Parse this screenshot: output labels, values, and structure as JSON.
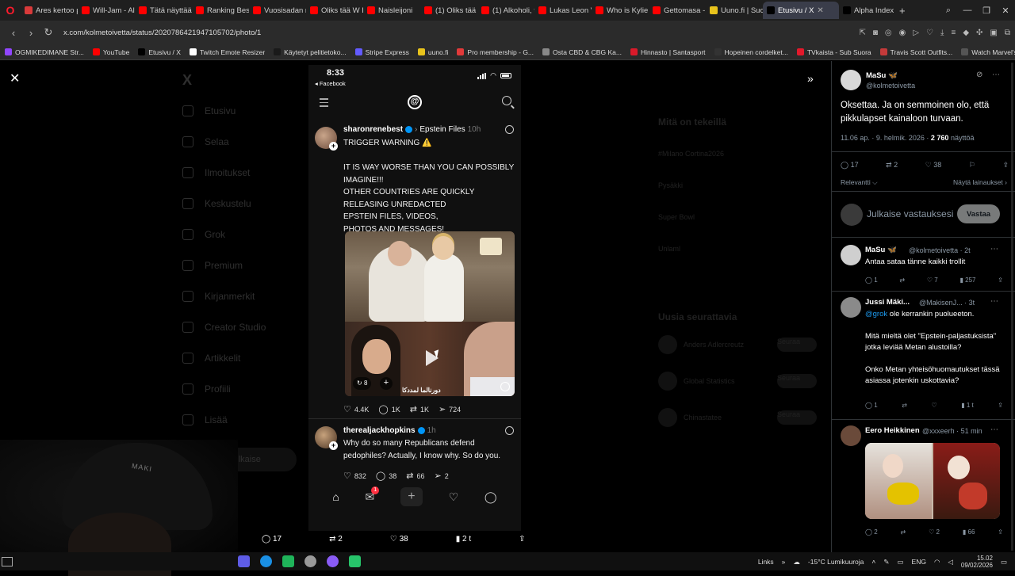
{
  "browser": {
    "tabs": [
      {
        "label": "Ares kertoo p",
        "fav": "#d93a3a"
      },
      {
        "label": "Will-Jam - Alk",
        "fav": "#ff0000"
      },
      {
        "label": "Tätä näyttää S",
        "fav": "#ff0000"
      },
      {
        "label": "Ranking Best I",
        "fav": "#ff0000"
      },
      {
        "label": "Vuosisadan ri",
        "fav": "#ff0000"
      },
      {
        "label": "Oliks tää W Ri",
        "fav": "#ff0000"
      },
      {
        "label": "Naisleijoni",
        "fav": "#ff0000"
      },
      {
        "label": "(1) Oliks tää W",
        "fav": "#ff0000"
      },
      {
        "label": "(1) Alkoholi, t",
        "fav": "#ff0000"
      },
      {
        "label": "Lukas Leon Vi",
        "fav": "#ff0000"
      },
      {
        "label": "Who is Kylie Je",
        "fav": "#ff0000"
      },
      {
        "label": "Gettomasa - S",
        "fav": "#ff0000"
      },
      {
        "label": "Uuno.fi | Suom",
        "fav": "#e8c31c"
      },
      {
        "label": "Etusivu / X",
        "fav": "#000000",
        "active": true
      },
      {
        "label": "Alpha Index X",
        "fav": "#000000"
      }
    ],
    "url": "x.com/kolmetoivetta/status/2020786421947105702/photo/1",
    "bookmarks": [
      {
        "label": "OGMIKEDIMANE Str...",
        "fav": "#9146ff"
      },
      {
        "label": "YouTube",
        "fav": "#ff0000"
      },
      {
        "label": "Etusivu / X",
        "fav": "#000000"
      },
      {
        "label": "Twitch Emote Resizer",
        "fav": "#ffffff"
      },
      {
        "label": "Käytetyt pelitietoko...",
        "fav": "#1a1a1a"
      },
      {
        "label": "Stripe Express",
        "fav": "#635bff"
      },
      {
        "label": "uuno.fi",
        "fav": "#e8c31c"
      },
      {
        "label": "Pro membership - G...",
        "fav": "#e23a3a"
      },
      {
        "label": "Osta CBD & CBG Ka...",
        "fav": "#888888"
      },
      {
        "label": "Hinnasto | Santasport",
        "fav": "#d91a2a"
      },
      {
        "label": "Hopeinen cordelket...",
        "fav": "#333333"
      },
      {
        "label": "TVkaista - Sub Suora",
        "fav": "#e3192b"
      },
      {
        "label": "Travis Scott Outfits...",
        "fav": "#c43a3a"
      },
      {
        "label": "Watch Marvel's Luk...",
        "fav": "#555555"
      }
    ]
  },
  "background": {
    "sidebar_items": [
      "Etusivu",
      "Selaa",
      "Ilmoitukset",
      "Keskustelu",
      "Grok",
      "Premium",
      "Kirjanmerkit",
      "Creator Studio",
      "Artikkelit",
      "Profiili",
      "Lisää"
    ],
    "post_button": "Julkaise",
    "trending_title": "Mitä on tekeillä",
    "trend_items": [
      "#Milano Cortina2026",
      "Pysäkki",
      "Super Bowl",
      "Unlaml"
    ],
    "follow_title": "Uusia seurattavia",
    "follow_items": [
      "Anders Adlercreutz",
      "Global Statistics",
      "Chinastatee"
    ],
    "follow_button": "Seuraa"
  },
  "phone": {
    "time": "8:33",
    "back_app": "◂ Facebook",
    "post1": {
      "user": "sharonrenebest",
      "topic": "Epstein Files",
      "time": "10h",
      "text": "TRIGGER WARNING ⚠️\n\nIT IS WAY WORSE THAN YOU CAN POSSIBLY IMAGINE!!!\nOTHER COUNTRIES ARE QUICKLY RELEASING UNREDACTED\nEPSTEIN FILES, VIDEOS,\nPHOTOS AND MESSAGES!",
      "media_count": "8",
      "subtitle": "ﺩﻭﺭﻧﺎﻟﻤﺎ ﻟﻤﺪﺩﻛﺎ",
      "likes": "4.4K",
      "comments": "1K",
      "reposts": "1K",
      "shares": "724"
    },
    "post2": {
      "user": "therealjackhopkins",
      "time": "1h",
      "text": "Why do so many Republicans defend pedophiles? Actually, I know why. So do you.",
      "likes": "832",
      "comments": "38",
      "reposts": "66",
      "shares": "2"
    },
    "activity_badge": "1"
  },
  "reply_panel": {
    "author_name": "MaSu 🦋",
    "author_handle": "@kolmetoivetta",
    "text": "Oksettaa. Ja on semmoinen olo, että pikkulapset kainaloon turvaan.",
    "meta_time": "11.06 ap. · 9. helmik. 2026 · ",
    "views": "2 760",
    "views_label": "näyttöä",
    "stats": {
      "replies": "17",
      "reposts": "2",
      "likes": "38"
    },
    "sort_label": "Relevantti ⌵",
    "show_quotes": "Näytä lainaukset ›",
    "compose_placeholder": "Julkaise vastauksesi",
    "reply_button": "Vastaa",
    "replies": [
      {
        "name": "MaSu 🦋",
        "handle": "@kolmetoivetta · 2t",
        "text": "Antaa sataa tänne kaikki trollit",
        "acts": [
          "1",
          "",
          "7",
          "257",
          ""
        ],
        "av": "#cfcfcf"
      },
      {
        "name": "Jussi Mäki...",
        "handle": "@MakisenJ... · 3t",
        "mention": "@grok",
        "text": " ole kerrankin puolueeton.\n\nMitä mieltä olet \"Epstein-paljastuksista\" jotka leviää Metan alustoilla?\n\nOnko Metan yhteisöhuomautukset tässä asiassa jotenkin uskottavia?",
        "acts": [
          "1",
          "",
          "",
          "1 t",
          ""
        ],
        "av": "#8a8a8a"
      },
      {
        "name": "Eero Heikkinen",
        "handle": "@xxxeerh · 51 min",
        "text": "",
        "acts": [
          "2",
          "",
          "2",
          "66",
          ""
        ],
        "av": "#6a4a3a"
      }
    ]
  },
  "bottom_bar": {
    "replies": "17",
    "reposts": "2",
    "likes": "38",
    "views": "2 t"
  },
  "taskbar": {
    "links": "Links",
    "weather": "-15°C Lumikuuroja",
    "lang": "ENG",
    "time": "15.02",
    "date": "09/02/2026"
  },
  "webcam_text": "MAKI"
}
